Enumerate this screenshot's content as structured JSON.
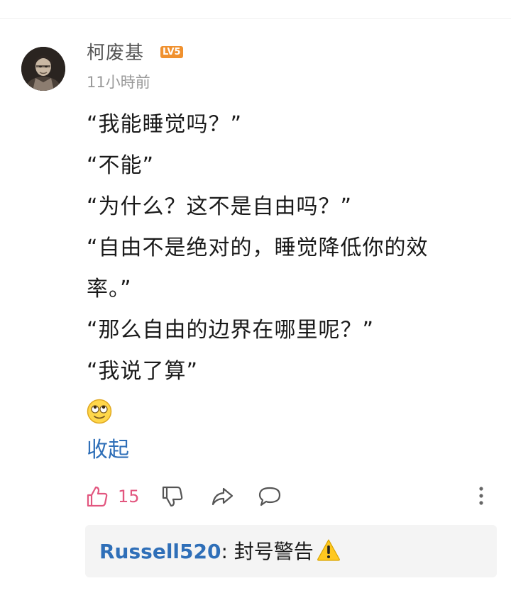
{
  "comment": {
    "author": {
      "name": "柯废基",
      "level_badge": "LV5",
      "avatar_icon": "user-avatar-photo"
    },
    "time": "11小時前",
    "lines": [
      "“我能睡觉吗？”",
      "“不能”",
      "“为什么？这不是自由吗？”",
      "“自由不是绝对的，睡觉降低你的效",
      "率。”",
      "“那么自由的边界在哪里呢？”",
      "“我说了算”"
    ],
    "emoji_icon": "rolling-eyes-smile-emoji",
    "collapse_label": "收起",
    "actions": {
      "like_icon": "thumbs-up-icon",
      "like_count": "15",
      "dislike_icon": "thumbs-down-icon",
      "share_icon": "share-icon",
      "reply_icon": "comment-bubble-icon",
      "more_icon": "more-vertical-icon"
    },
    "reply": {
      "user": "Russell520",
      "separator": ":",
      "text": " 封号警告",
      "icon": "warning-icon"
    }
  },
  "colors": {
    "accent_link": "#2f6fb8",
    "like_pink": "#e2567f",
    "badge_orange": "#f0912f",
    "meta_gray": "#999999",
    "reply_bg": "#f4f4f4"
  }
}
